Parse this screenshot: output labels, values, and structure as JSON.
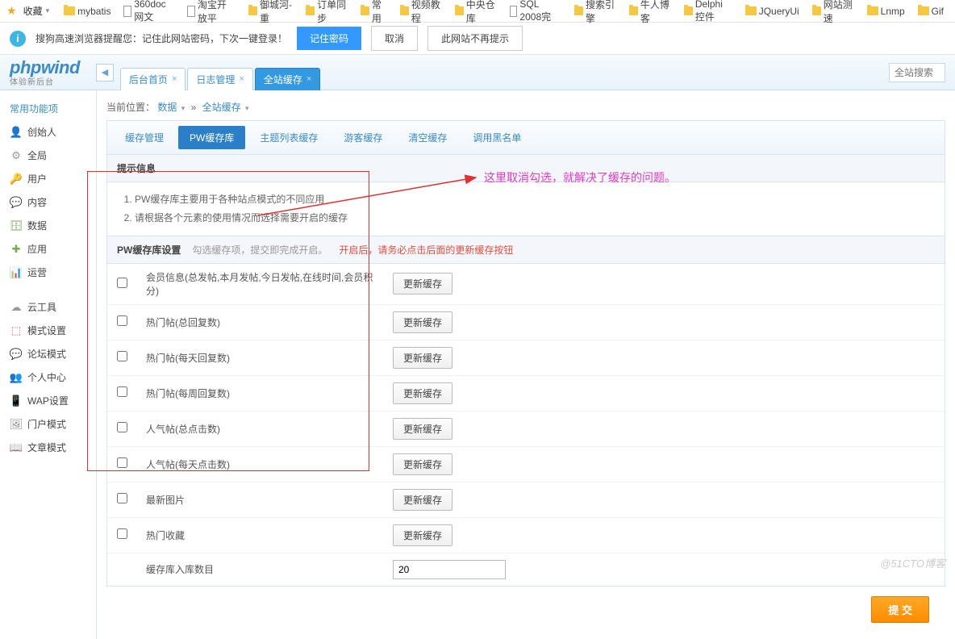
{
  "bookmarks": {
    "fav_label": "收藏",
    "items": [
      {
        "type": "folder",
        "label": "mybatis"
      },
      {
        "type": "page",
        "label": "360doc网文"
      },
      {
        "type": "page",
        "label": "淘宝开放平"
      },
      {
        "type": "folder",
        "label": "御城河-重"
      },
      {
        "type": "folder",
        "label": "订单同步"
      },
      {
        "type": "folder",
        "label": "常用"
      },
      {
        "type": "folder",
        "label": "视频教程"
      },
      {
        "type": "folder",
        "label": "中央仓库"
      },
      {
        "type": "page",
        "label": "SQL 2008完"
      },
      {
        "type": "folder",
        "label": "搜索引擎"
      },
      {
        "type": "folder",
        "label": "牛人博客"
      },
      {
        "type": "folder",
        "label": "Delphi控件"
      },
      {
        "type": "folder",
        "label": "JQueryUi"
      },
      {
        "type": "folder",
        "label": "网站测速"
      },
      {
        "type": "folder",
        "label": "Lnmp"
      },
      {
        "type": "folder",
        "label": "Gif"
      }
    ]
  },
  "notice": {
    "icon_text": "i",
    "text": "搜狗高速浏览器提醒您：记住此网站密码，下次一键登录！",
    "remember": "记住密码",
    "cancel": "取消",
    "never": "此网站不再提示"
  },
  "header": {
    "logo": "phpwind",
    "logo_sub": "体验新后台",
    "back_symbol": "◀",
    "tabs": [
      {
        "label": "后台首页",
        "close": "×"
      },
      {
        "label": "日志管理",
        "close": "×"
      },
      {
        "label": "全站缓存",
        "close": "×",
        "active": true
      }
    ],
    "search_placeholder": "全站搜索"
  },
  "sidebar": {
    "section": "常用功能项",
    "groups": [
      [
        {
          "icon": "👤",
          "color": "#d68a3a",
          "label": "创始人"
        },
        {
          "icon": "⚙",
          "color": "#999",
          "label": "全局"
        },
        {
          "icon": "🔑",
          "color": "#c0a050",
          "label": "用户"
        },
        {
          "icon": "💬",
          "color": "#3a8ed6",
          "label": "内容"
        },
        {
          "icon": "🗄",
          "color": "#7aa85a",
          "label": "数据"
        },
        {
          "icon": "✚",
          "color": "#6ab04c",
          "label": "应用"
        },
        {
          "icon": "📊",
          "color": "#d68a3a",
          "label": "运营"
        }
      ],
      [
        {
          "icon": "☁",
          "color": "#999",
          "label": "云工具"
        },
        {
          "icon": "⬚",
          "color": "#d05050",
          "label": "模式设置"
        },
        {
          "icon": "💬",
          "color": "#888",
          "label": "论坛模式"
        },
        {
          "icon": "👥",
          "color": "#5a9fd6",
          "label": "个人中心"
        },
        {
          "icon": "📱",
          "color": "#888",
          "label": "WAP设置"
        },
        {
          "icon": "🖼",
          "color": "#888",
          "label": "门户模式"
        },
        {
          "icon": "📖",
          "color": "#888",
          "label": "文章模式"
        }
      ]
    ]
  },
  "breadcrumb": {
    "label": "当前位置：",
    "data": "数据",
    "sep": "»",
    "current": "全站缓存"
  },
  "subtabs": [
    "缓存管理",
    "PW缓存库",
    "主题列表缓存",
    "游客缓存",
    "清空缓存",
    "调用黑名单"
  ],
  "subtab_active": 1,
  "tips": {
    "title": "提示信息",
    "items": [
      "PW缓存库主要用于各种站点模式的不同应用",
      "请根据各个元素的使用情况而选择需要开启的缓存"
    ]
  },
  "settings": {
    "title": "PW缓存库设置",
    "hint": "勾选缓存项，提交即完成开启。",
    "warn": "开启后，请务必点击后面的更新缓存按钮",
    "update_label": "更新缓存",
    "rows": [
      {
        "label": "会员信息(总发帖,本月发帖,今日发帖,在线时间,会员积分)"
      },
      {
        "label": "热门帖(总回复数)"
      },
      {
        "label": "热门帖(每天回复数)"
      },
      {
        "label": "热门帖(每周回复数)"
      },
      {
        "label": "人气帖(总点击数)"
      },
      {
        "label": "人气帖(每天点击数)"
      },
      {
        "label": "最新图片"
      },
      {
        "label": "热门收藏"
      }
    ],
    "count_label": "缓存库入库数目",
    "count_value": "20"
  },
  "submit_label": "提 交",
  "annotation": "这里取消勾选，就解决了缓存的问题。",
  "watermark": "@51CTO博客"
}
